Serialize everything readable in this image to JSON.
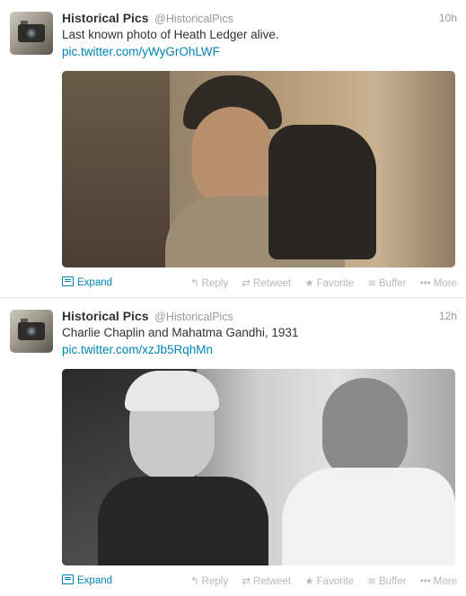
{
  "tweets": [
    {
      "name": "Historical Pics",
      "handle": "@HistoricalPics",
      "time": "10h",
      "text": "Last known photo of Heath Ledger alive.",
      "link": "pic.twitter.com/yWyGrOhLWF",
      "expand": "Expand",
      "actions": {
        "reply": "Reply",
        "retweet": "Retweet",
        "favorite": "Favorite",
        "buffer": "Buffer",
        "more": "More"
      }
    },
    {
      "name": "Historical Pics",
      "handle": "@HistoricalPics",
      "time": "12h",
      "text": "Charlie Chaplin and Mahatma Gandhi, 1931",
      "link": "pic.twitter.com/xzJb5RqhMn",
      "expand": "Expand",
      "actions": {
        "reply": "Reply",
        "retweet": "Retweet",
        "favorite": "Favorite",
        "buffer": "Buffer",
        "more": "More"
      }
    }
  ],
  "icons": {
    "reply": "reply-icon",
    "retweet": "retweet-icon",
    "favorite": "star-icon",
    "buffer": "buffer-icon",
    "more": "ellipsis-icon",
    "expand": "media-icon"
  },
  "colors": {
    "link": "#0084b4",
    "muted": "#999999",
    "action": "#b8b8b8"
  }
}
